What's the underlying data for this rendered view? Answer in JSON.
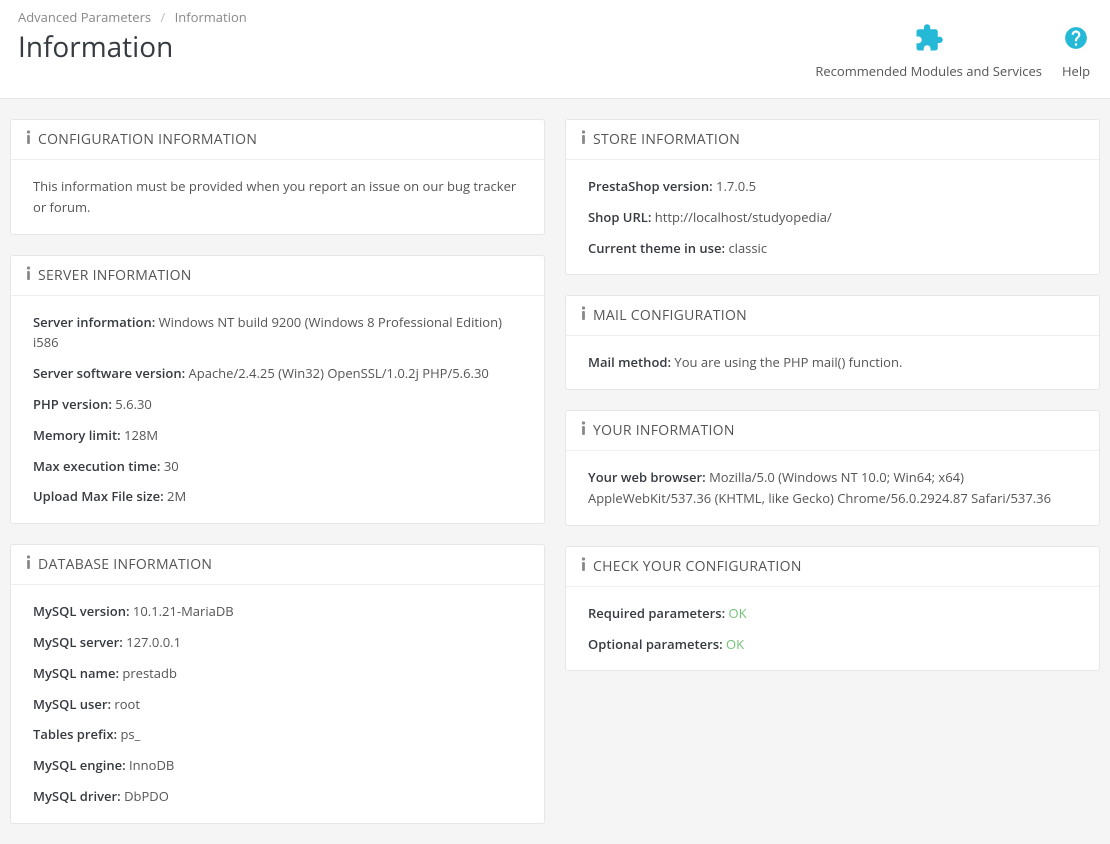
{
  "breadcrumb": {
    "parent": "Advanced Parameters",
    "current": "Information"
  },
  "page_title": "Information",
  "header_actions": {
    "modules": "Recommended Modules and Services",
    "help": "Help"
  },
  "panels": {
    "config_info": {
      "title": "CONFIGURATION INFORMATION",
      "text": "This information must be provided when you report an issue on our bug tracker or forum."
    },
    "server_info": {
      "title": "SERVER INFORMATION",
      "items": [
        {
          "label": "Server information:",
          "value": "Windows NT build 9200 (Windows 8 Professional Edition) i586"
        },
        {
          "label": "Server software version:",
          "value": "Apache/2.4.25 (Win32) OpenSSL/1.0.2j PHP/5.6.30"
        },
        {
          "label": "PHP version:",
          "value": "5.6.30"
        },
        {
          "label": "Memory limit:",
          "value": "128M"
        },
        {
          "label": "Max execution time:",
          "value": "30"
        },
        {
          "label": "Upload Max File size:",
          "value": "2M"
        }
      ]
    },
    "db_info": {
      "title": "DATABASE INFORMATION",
      "items": [
        {
          "label": "MySQL version:",
          "value": "10.1.21-MariaDB"
        },
        {
          "label": "MySQL server:",
          "value": "127.0.0.1"
        },
        {
          "label": "MySQL name:",
          "value": "prestadb"
        },
        {
          "label": "MySQL user:",
          "value": "root"
        },
        {
          "label": "Tables prefix:",
          "value": "ps_"
        },
        {
          "label": "MySQL engine:",
          "value": "InnoDB"
        },
        {
          "label": "MySQL driver:",
          "value": "DbPDO"
        }
      ]
    },
    "store_info": {
      "title": "STORE INFORMATION",
      "items": [
        {
          "label": "PrestaShop version:",
          "value": "1.7.0.5"
        },
        {
          "label": "Shop URL:",
          "value": "http://localhost/studyopedia/"
        },
        {
          "label": "Current theme in use:",
          "value": "classic"
        }
      ]
    },
    "mail_config": {
      "title": "MAIL CONFIGURATION",
      "items": [
        {
          "label": "Mail method:",
          "value": "You are using the PHP mail() function."
        }
      ]
    },
    "your_info": {
      "title": "YOUR INFORMATION",
      "items": [
        {
          "label": "Your web browser:",
          "value": "Mozilla/5.0 (Windows NT 10.0; Win64; x64) AppleWebKit/537.36 (KHTML, like Gecko) Chrome/56.0.2924.87 Safari/537.36"
        }
      ]
    },
    "check_config": {
      "title": "CHECK YOUR CONFIGURATION",
      "items": [
        {
          "label": "Required parameters:",
          "value": "OK",
          "ok": true
        },
        {
          "label": "Optional parameters:",
          "value": "OK",
          "ok": true
        }
      ]
    }
  }
}
